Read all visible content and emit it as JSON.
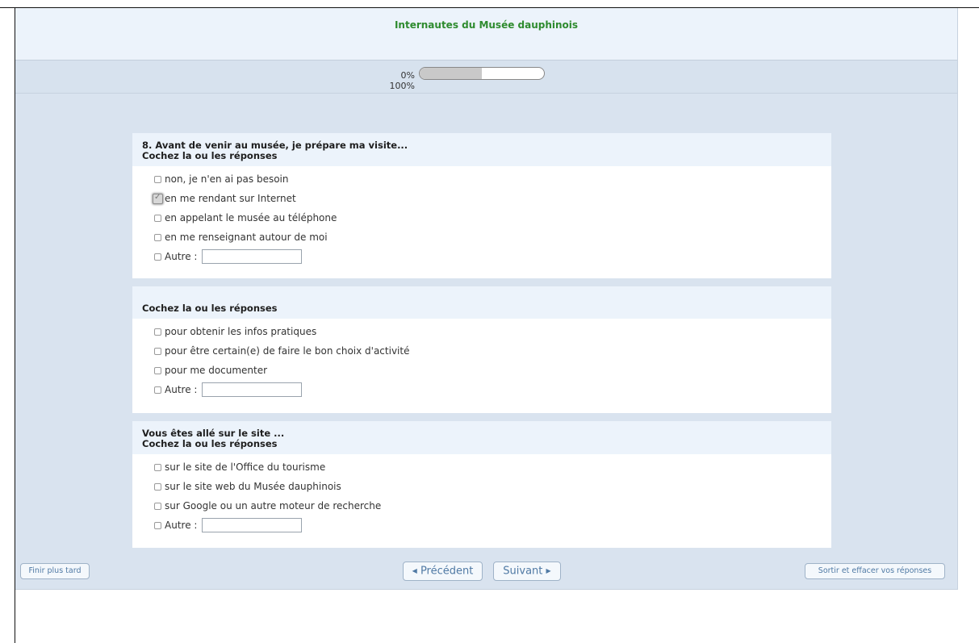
{
  "survey": {
    "title": "Internautes du Musée dauphinois",
    "progress": {
      "start_label": "0%",
      "end_label": "100%",
      "fill_fraction": 0.5
    }
  },
  "questions": [
    {
      "title": "8. Avant de venir au musée, je prépare ma visite...",
      "instruction": "Cochez la ou les réponses",
      "options": [
        {
          "label": "non, je n'en ai pas besoin",
          "checked": false
        },
        {
          "label": "en me rendant sur Internet",
          "checked": true
        },
        {
          "label": "en appelant le musée au téléphone",
          "checked": false
        },
        {
          "label": "en me renseignant autour de moi",
          "checked": false
        },
        {
          "label": "Autre :",
          "checked": false,
          "has_input": true
        }
      ]
    },
    {
      "title": "",
      "instruction": "Cochez la ou les réponses",
      "options": [
        {
          "label": "pour obtenir les infos pratiques",
          "checked": false
        },
        {
          "label": "pour être certain(e) de faire le bon choix d'activité",
          "checked": false
        },
        {
          "label": "pour me documenter",
          "checked": false
        },
        {
          "label": "Autre :",
          "checked": false,
          "has_input": true
        }
      ]
    },
    {
      "title": "Vous êtes allé sur le site ...",
      "instruction": "Cochez la ou les réponses",
      "options": [
        {
          "label": "sur le site de l'Office du tourisme",
          "checked": false
        },
        {
          "label": "sur le site web du Musée dauphinois",
          "checked": false
        },
        {
          "label": "sur Google ou un autre moteur de recherche",
          "checked": false
        },
        {
          "label": "Autre :",
          "checked": false,
          "has_input": true
        }
      ]
    }
  ],
  "footer": {
    "finish_later": "Finir plus tard",
    "previous": "Précédent",
    "next": "Suivant",
    "exit_clear": "Sortir et effacer vos réponses"
  }
}
